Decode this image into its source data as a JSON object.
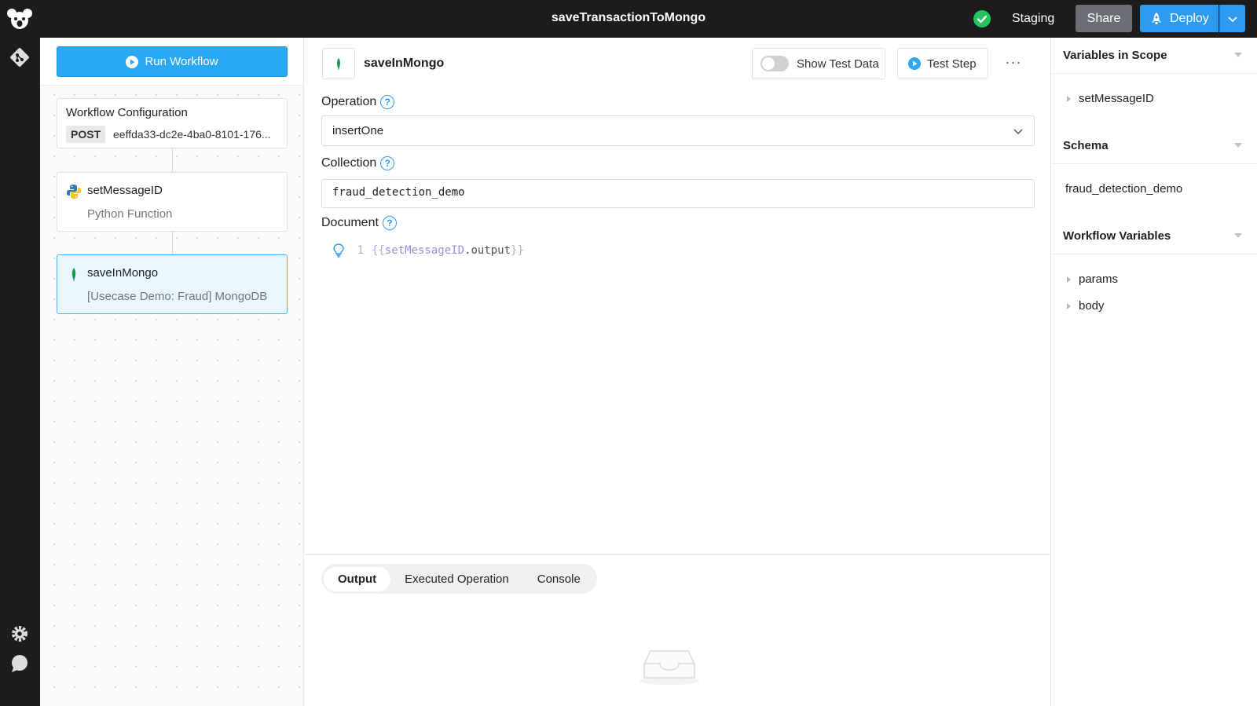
{
  "topbar": {
    "title": "saveTransactionToMongo",
    "environment": "Staging",
    "share_label": "Share",
    "deploy_label": "Deploy",
    "status_color": "#22c55e",
    "accent_color": "#2b9cf2"
  },
  "workflow": {
    "run_label": "Run Workflow",
    "config": {
      "title": "Workflow Configuration",
      "method": "POST",
      "endpoint": "eeffda33-dc2e-4ba0-8101-176..."
    },
    "nodes": [
      {
        "name": "setMessageID",
        "subtitle": "Python Function",
        "icon": "python-icon"
      },
      {
        "name": "saveInMongo",
        "subtitle": "[Usecase Demo: Fraud] MongoDB",
        "icon": "mongodb-leaf-icon"
      }
    ]
  },
  "editor": {
    "step_name": "saveInMongo",
    "show_test_data_label": "Show Test Data",
    "test_step_label": "Test Step",
    "more_label": "···",
    "operation_label": "Operation",
    "operation_value": "insertOne",
    "collection_label": "Collection",
    "collection_value": "fraud_detection_demo",
    "document_label": "Document",
    "code": {
      "line_number": "1",
      "open": "{{",
      "var": "setMessageID",
      "prop": ".output",
      "close": "}}"
    }
  },
  "bottom_tabs": [
    "Output",
    "Executed Operation",
    "Console"
  ],
  "sidebar_right": {
    "variables_in_scope": {
      "title": "Variables in Scope",
      "items": [
        "setMessageID"
      ]
    },
    "schema": {
      "title": "Schema",
      "value": "fraud_detection_demo"
    },
    "workflow_variables": {
      "title": "Workflow Variables",
      "items": [
        "params",
        "body"
      ]
    }
  }
}
